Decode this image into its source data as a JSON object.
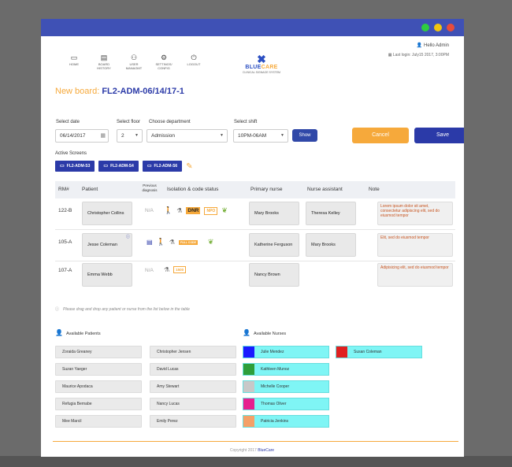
{
  "colors": {
    "titlebar": "#3f51b5",
    "accent_orange": "#f6a93b",
    "accent_blue": "#2b3aa8",
    "dot_green": "#2ecc40",
    "dot_yellow": "#f1c40f",
    "dot_red": "#e74c3c"
  },
  "nav": [
    {
      "label": "HOME",
      "icon": "monitor-icon"
    },
    {
      "label": "BOARD HISTORY",
      "icon": "history-icon"
    },
    {
      "label": "USER MANAGMT",
      "icon": "users-icon"
    },
    {
      "label": "SETTINGS/ CONFIG",
      "icon": "gear-icon"
    },
    {
      "label": "LOGOUT",
      "icon": "power-icon"
    }
  ],
  "logo": {
    "part1": "BLUE",
    "part2": "CARE",
    "sub": "CLINICAL SIGNAGE SYSTEM"
  },
  "user": {
    "greeting": "Hello Admin",
    "last_login": "Last login: July15 2017, 3:00PM"
  },
  "board": {
    "label": "New board:",
    "code": "FL2-ADM-06/14/17-1"
  },
  "filters": {
    "date_label": "Select date",
    "date_value": "06/14/2017",
    "floor_label": "Select floor",
    "floor_value": "2",
    "dept_label": "Choose department",
    "dept_value": "Admission",
    "shift_label": "Select shift",
    "shift_value": "10PM-06AM"
  },
  "buttons": {
    "show": "Show",
    "cancel": "Cancel",
    "save": "Save"
  },
  "active_screens_label": "Active Screens",
  "screens": [
    "FL2-ADM-S3",
    "FL2-ADM-S4",
    "FL2-ADM-S6"
  ],
  "table_headers": {
    "rm": "RM#",
    "patient": "Patient",
    "prev": "Previous diagnosis",
    "iso": "Isolation & code status",
    "nurse": "Primary nurse",
    "assistant": "Nurse assistant",
    "note": "Note"
  },
  "rows": [
    {
      "rm": "122-B",
      "patient": "Christopher Collins",
      "prev": "N/A",
      "tags": [
        "DNR",
        "NPO"
      ],
      "nurse": "Mary Brooks",
      "assistant": "Theresa Kelley",
      "note": "Lorem ipsum dolor sit amet, consectetur adipiscing elit, sed do eiusmod tempor"
    },
    {
      "rm": "105-A",
      "patient": "Jesse Coleman",
      "prev": "",
      "tags": [
        "FULL CODE"
      ],
      "nurse": "Katherine Ferguson",
      "assistant": "Mary Brooks",
      "note": "Elit, sed do eiusmod tempor"
    },
    {
      "rm": "107-A",
      "patient": "Emma Webb",
      "prev": "N/A",
      "tags": [
        "1500"
      ],
      "nurse": "Nancy Brown",
      "assistant": "",
      "note": "Adipisicing elit, sed do eiusmod tempor"
    }
  ],
  "drag_hint": "Please drag and drop any patient or nurse from the list below in the table",
  "available_patients_label": "Available Patients",
  "available_nurses_label": "Available Nurses",
  "patients": [
    [
      "Zoraida Greaney",
      "Christopher Jensen"
    ],
    [
      "Suzan Yaeger",
      "David Lucas"
    ],
    [
      "Maurice Apodaca",
      "Amy Stewart"
    ],
    [
      "Refugia Bernabe",
      "Nancy Lucas"
    ],
    [
      "Mee Marcil",
      "Emily Perez"
    ]
  ],
  "nurses": [
    {
      "name": "Julie Mendez",
      "color": "#1a1aff"
    },
    {
      "name": "Kathleen Munoz",
      "color": "#2e9e3a"
    },
    {
      "name": "Michelle Cooper",
      "color": "#c8c8c8"
    },
    {
      "name": "Thomas Oliver",
      "color": "#e6208f"
    },
    {
      "name": "Patricia Jenkins",
      "color": "#f4a068"
    },
    {
      "name": "Susan Coleman",
      "color": "#e02020"
    }
  ],
  "footer": {
    "text": "Copyright 2017",
    "brand": "BlueCare"
  }
}
